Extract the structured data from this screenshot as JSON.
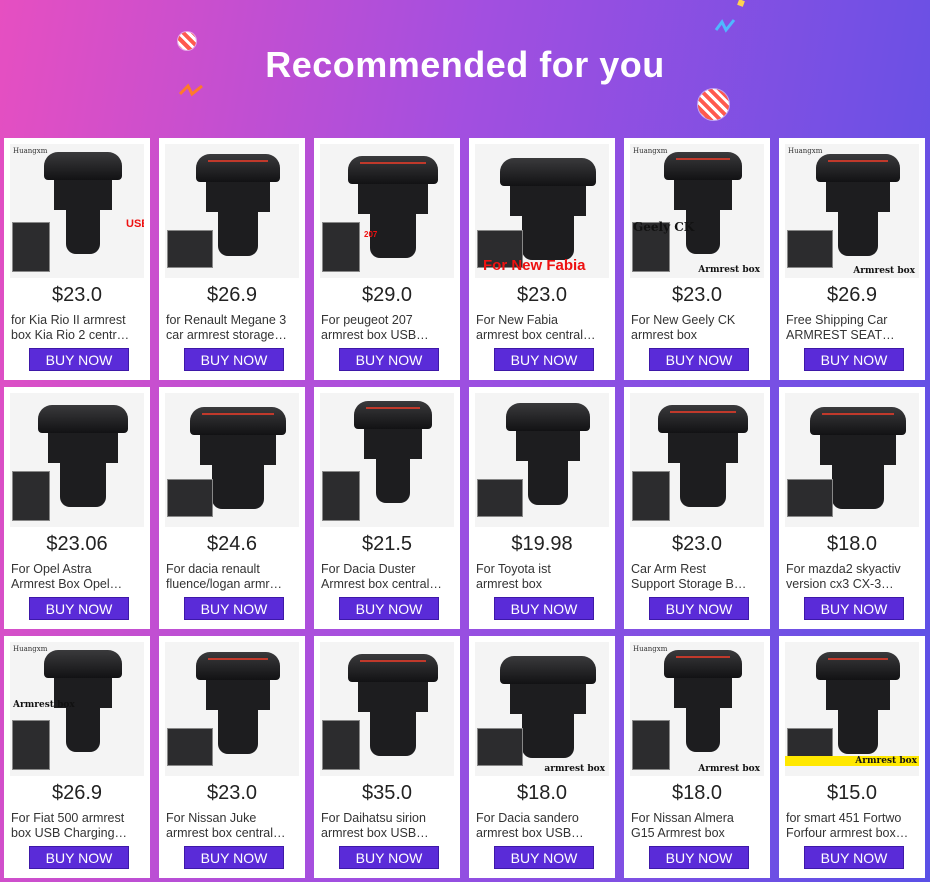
{
  "header": {
    "title": "Recommended for you",
    "colors": {
      "gradient_start": "#e64fc1",
      "gradient_end": "#5a50e6",
      "button": "#5a2bd8"
    }
  },
  "products": [
    {
      "price": "$23.0",
      "title1": "for Kia Rio II armrest",
      "title2": "box Kia Rio 2 centr…",
      "button": "BUY NOW",
      "img_label": "USB",
      "brand": "Huangxm"
    },
    {
      "price": "$26.9",
      "title1": "for Renault Megane 3",
      "title2": "car armrest storage…",
      "button": "BUY NOW"
    },
    {
      "price": "$29.0",
      "title1": "For peugeot 207",
      "title2": "armrest box USB…",
      "button": "BUY NOW",
      "img_label": "207"
    },
    {
      "price": "$23.0",
      "title1": "For New Fabia",
      "title2": "armrest box central…",
      "button": "BUY NOW",
      "img_label": "For New Fabia"
    },
    {
      "price": "$23.0",
      "title1": "For New Geely CK",
      "title2": "armrest box",
      "button": "BUY NOW",
      "img_label": "Geely CK",
      "img_label2": "Armrest box",
      "brand": "Huangxm"
    },
    {
      "price": "$26.9",
      "title1": "Free Shipping Car",
      "title2": "ARMREST SEAT…",
      "button": "BUY NOW",
      "img_label": "Armrest box",
      "brand": "Huangxm"
    },
    {
      "price": "$23.06",
      "title1": "For Opel Astra",
      "title2": "Armrest Box Opel…",
      "button": "BUY NOW"
    },
    {
      "price": "$24.6",
      "title1": "For dacia renault",
      "title2": "fluence/logan armr…",
      "button": "BUY NOW"
    },
    {
      "price": "$21.5",
      "title1": "For Dacia Duster",
      "title2": "Armrest box central…",
      "button": "BUY NOW"
    },
    {
      "price": "$19.98",
      "title1": "For Toyota ist",
      "title2": "armrest box",
      "button": "BUY NOW"
    },
    {
      "price": "$23.0",
      "title1": "Car Arm Rest",
      "title2": "Support Storage B…",
      "button": "BUY NOW"
    },
    {
      "price": "$18.0",
      "title1": "For mazda2 skyactiv",
      "title2": "version cx3 CX-3…",
      "button": "BUY NOW"
    },
    {
      "price": "$26.9",
      "title1": "For Fiat 500 armrest",
      "title2": "box USB Charging…",
      "button": "BUY NOW",
      "img_label": "Armrest box",
      "brand": "Huangxm"
    },
    {
      "price": "$23.0",
      "title1": "For Nissan Juke",
      "title2": "armrest box central…",
      "button": "BUY NOW"
    },
    {
      "price": "$35.0",
      "title1": "For Daihatsu sirion",
      "title2": "armrest box USB…",
      "button": "BUY NOW"
    },
    {
      "price": "$18.0",
      "title1": "For Dacia sandero",
      "title2": "armrest box USB…",
      "button": "BUY NOW",
      "img_label": "armrest box"
    },
    {
      "price": "$18.0",
      "title1": "For Nissan Almera",
      "title2": "G15 Armrest box",
      "button": "BUY NOW",
      "img_label": "Armrest box",
      "brand": "Huangxm"
    },
    {
      "price": "$15.0",
      "title1": "for smart 451 Fortwo",
      "title2": "Forfour armrest box…",
      "button": "BUY NOW",
      "img_label": "Armrest box"
    }
  ]
}
